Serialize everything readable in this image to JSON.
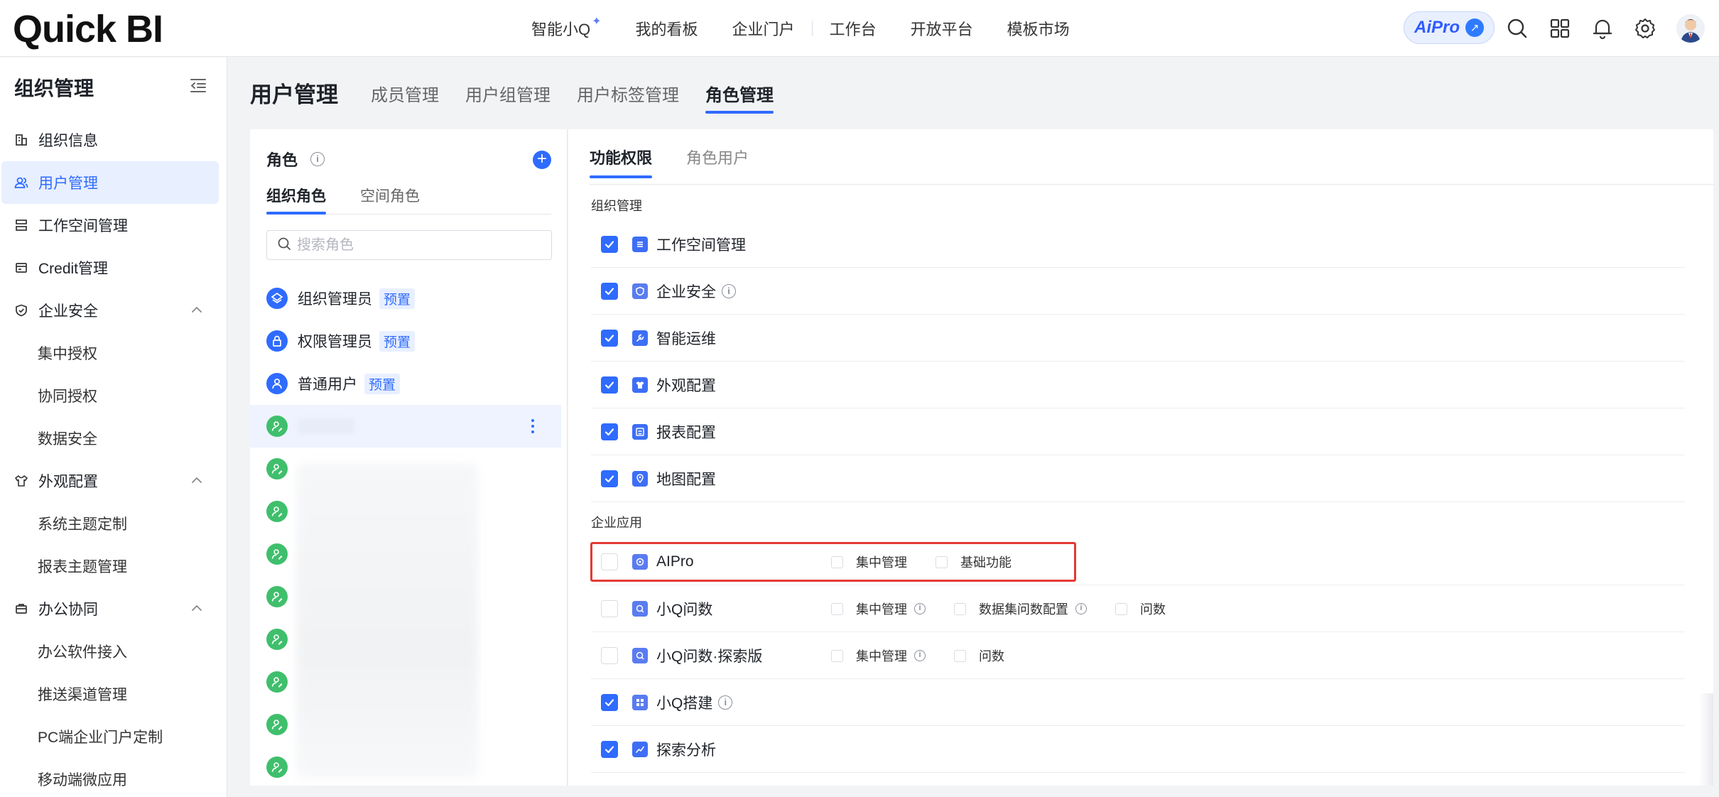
{
  "app": {
    "logo": "Quick BI"
  },
  "topnav": {
    "ai_label": "智能小Q",
    "items": [
      "我的看板",
      "企业门户",
      "工作台",
      "开放平台",
      "模板市场"
    ],
    "aipro_label": "AiPro"
  },
  "sidebar": {
    "title": "组织管理",
    "items": [
      {
        "label": "组织信息",
        "icon": "building-icon"
      },
      {
        "label": "用户管理",
        "icon": "users-icon",
        "active": true
      },
      {
        "label": "工作空间管理",
        "icon": "workspace-icon"
      },
      {
        "label": "Credit管理",
        "icon": "credit-icon"
      },
      {
        "label": "企业安全",
        "icon": "shield-icon",
        "expanded": true
      },
      {
        "label": "集中授权"
      },
      {
        "label": "协同授权"
      },
      {
        "label": "数据安全"
      },
      {
        "label": "外观配置",
        "icon": "shirt-icon",
        "expanded": true
      },
      {
        "label": "系统主题定制"
      },
      {
        "label": "报表主题管理"
      },
      {
        "label": "办公协同",
        "icon": "office-icon",
        "expanded": true
      },
      {
        "label": "办公软件接入"
      },
      {
        "label": "推送渠道管理"
      },
      {
        "label": "PC端企业门户定制"
      },
      {
        "label": "移动端微应用"
      }
    ]
  },
  "main": {
    "title": "用户管理",
    "tabs": [
      "成员管理",
      "用户组管理",
      "用户标签管理",
      "角色管理"
    ],
    "active_tab": "角色管理"
  },
  "roles": {
    "header": "角色",
    "tabs": [
      "组织角色",
      "空间角色"
    ],
    "search_placeholder": "搜索角色",
    "preset_tag": "预置",
    "items": [
      {
        "name": "组织管理员",
        "preset": true
      },
      {
        "name": "权限管理员",
        "preset": true
      },
      {
        "name": "普通用户",
        "preset": true
      }
    ]
  },
  "permissions": {
    "tabs": [
      "功能权限",
      "角色用户"
    ],
    "sections": [
      {
        "label": "组织管理",
        "items": [
          {
            "label": "工作空间管理",
            "checked": true
          },
          {
            "label": "企业安全",
            "checked": true,
            "info": true
          },
          {
            "label": "智能运维",
            "checked": true
          },
          {
            "label": "外观配置",
            "checked": true
          },
          {
            "label": "报表配置",
            "checked": true
          },
          {
            "label": "地图配置",
            "checked": true
          }
        ]
      },
      {
        "label": "企业应用",
        "items": [
          {
            "label": "AIPro",
            "checked": false,
            "sub": [
              "集中管理",
              "基础功能"
            ]
          },
          {
            "label": "小Q问数",
            "checked": false,
            "sub": [
              "集中管理",
              "数据集问数配置",
              "问数"
            ]
          },
          {
            "label": "小Q问数·探索版",
            "checked": false,
            "sub": [
              "集中管理",
              "问数"
            ]
          },
          {
            "label": "小Q搭建",
            "checked": true,
            "info": true
          },
          {
            "label": "探索分析",
            "checked": true
          }
        ]
      }
    ]
  },
  "colors": {
    "accent": "#2f6bff",
    "highlight": "#e53935",
    "role_green": "#3fbf6c"
  }
}
